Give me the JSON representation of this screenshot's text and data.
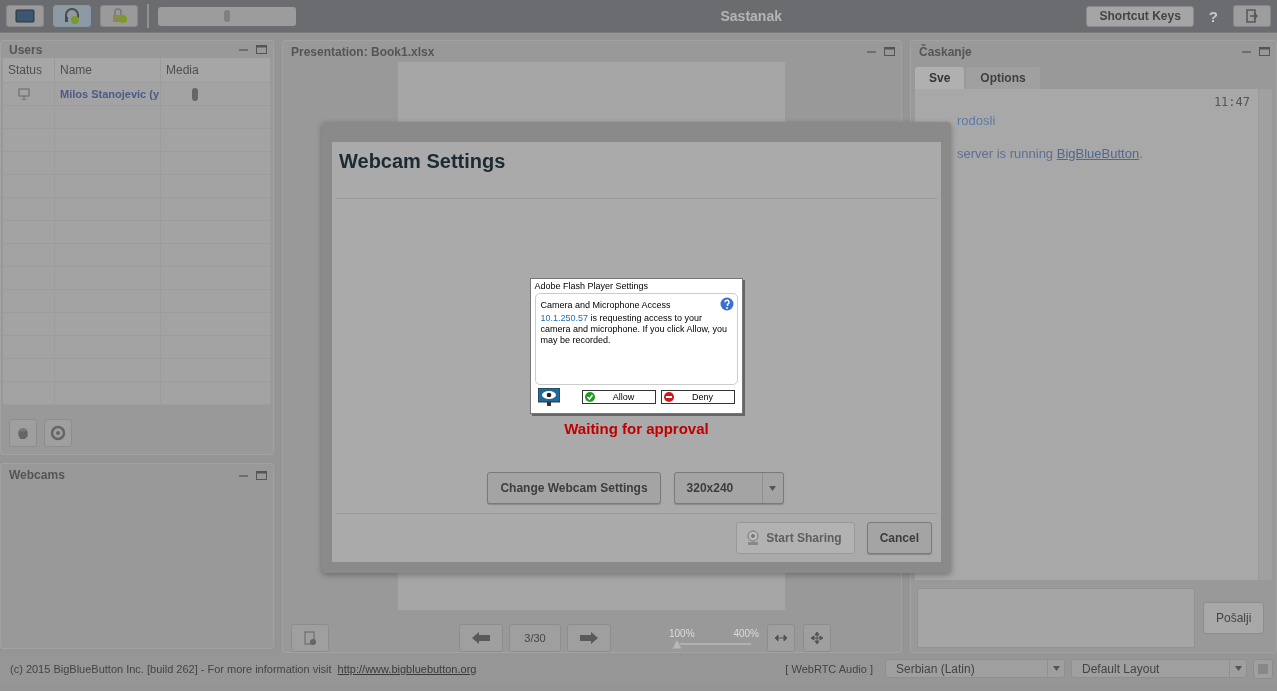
{
  "top_bar": {
    "buttons": [
      {
        "kind": "monitor",
        "selected": false
      },
      {
        "kind": "headset",
        "selected": true
      },
      {
        "kind": "lock",
        "selected": false
      }
    ],
    "title": "Sastanak",
    "shortcut_button": "Shortcut Keys",
    "help": "?"
  },
  "users_panel": {
    "title": "Users",
    "columns": [
      "Status",
      "Name",
      "Media"
    ],
    "rows": [
      {
        "name": "Milos Stanojevic (y"
      }
    ]
  },
  "webcams_panel": {
    "title": "Webcams"
  },
  "presentation": {
    "title": "Presentation: Book1.xlsx",
    "page": "3/30",
    "zoom_min": "100%",
    "zoom_max": "400%",
    "zoom": {
      "level": 0
    }
  },
  "chat": {
    "title": "Časkanje",
    "tabs": [
      {
        "label": "Sve",
        "selected": true
      },
      {
        "label": "Options",
        "selected": false
      }
    ],
    "time": "11:47",
    "messages": [
      "rodosli",
      "server is running **BigBlueButton**."
    ],
    "send": "Pošalji"
  },
  "footer": {
    "copyright": "(c) 2015 BigBlueButton Inc. [build 262] - For more information visit",
    "link": "http://www.bigbluebutton.org",
    "audio": "[ WebRTC Audio ]",
    "language": "Serbian (Latin)",
    "layout": "Default Layout"
  },
  "dialog": {
    "title": "Webcam Settings",
    "flash": {
      "title": "Adobe Flash Player Settings",
      "heading": "Camera and Microphone Access",
      "host": "10.1.250.57",
      "message": "is requesting access to your camera and microphone. If you click Allow, you may be recorded.",
      "allow": "Allow",
      "deny": "Deny"
    },
    "status": "Waiting for approval",
    "change_button": "Change Webcam Settings",
    "resolution": "320x240",
    "start_button": {
      "label": "Start Sharing",
      "disabled": true
    },
    "cancel_button": "Cancel"
  }
}
